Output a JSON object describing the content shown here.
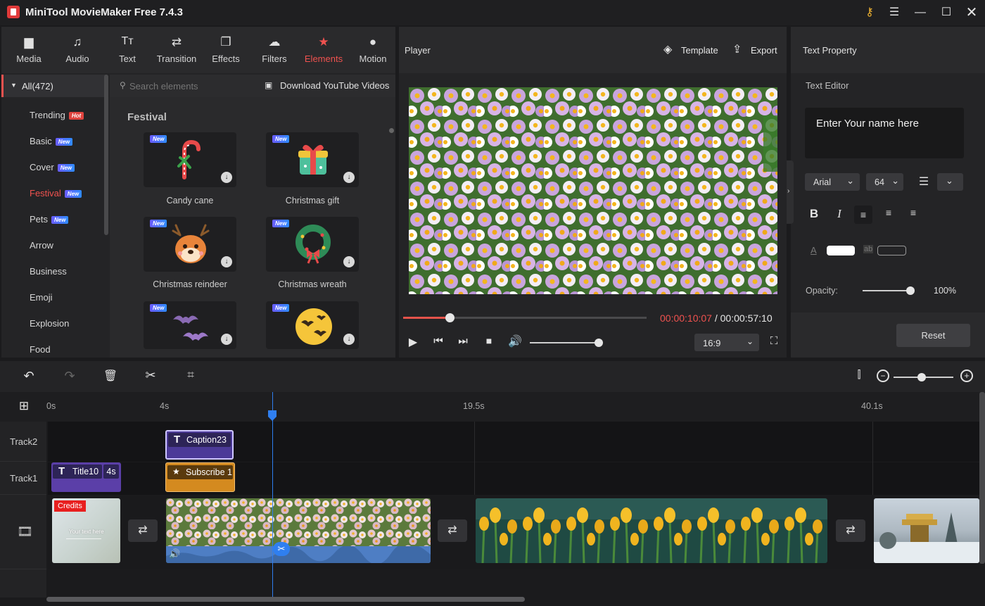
{
  "window": {
    "title": "MiniTool MovieMaker Free 7.4.3"
  },
  "tabs": [
    {
      "label": "Media",
      "icon": "folder-icon"
    },
    {
      "label": "Audio",
      "icon": "music-note-icon"
    },
    {
      "label": "Text",
      "icon": "text-icon"
    },
    {
      "label": "Transition",
      "icon": "transition-arrows-icon"
    },
    {
      "label": "Effects",
      "icon": "effects-icon"
    },
    {
      "label": "Filters",
      "icon": "filters-icon"
    },
    {
      "label": "Elements",
      "icon": "elements-icon"
    },
    {
      "label": "Motion",
      "icon": "motion-icon"
    }
  ],
  "active_tab": "Elements",
  "categories": {
    "all": "All(472)",
    "items": [
      {
        "label": "Trending",
        "badge": "Hot"
      },
      {
        "label": "Basic",
        "badge": "New"
      },
      {
        "label": "Cover",
        "badge": "New"
      },
      {
        "label": "Festival",
        "badge": "New"
      },
      {
        "label": "Pets",
        "badge": "New"
      },
      {
        "label": "Arrow",
        "badge": ""
      },
      {
        "label": "Business",
        "badge": ""
      },
      {
        "label": "Emoji",
        "badge": ""
      },
      {
        "label": "Explosion",
        "badge": ""
      },
      {
        "label": "Food",
        "badge": ""
      }
    ],
    "active": "Festival"
  },
  "search": {
    "placeholder": "Search elements",
    "download_label": "Download YouTube Videos"
  },
  "section_title": "Festival",
  "elements": [
    {
      "name": "Candy cane",
      "badge": "New"
    },
    {
      "name": "Christmas gift",
      "badge": "New"
    },
    {
      "name": "Christmas reindeer",
      "badge": "New"
    },
    {
      "name": "Christmas wreath",
      "badge": "New"
    },
    {
      "name": "",
      "badge": "New"
    },
    {
      "name": "",
      "badge": "New"
    }
  ],
  "player": {
    "title": "Player",
    "template_label": "Template",
    "export_label": "Export",
    "current_time": "00:00:10:07",
    "separator": " / ",
    "total_time": "00:00:57:10",
    "progress": 0.19,
    "volume": 0.98,
    "aspect_ratio": "16:9"
  },
  "text_property": {
    "title": "Text Property",
    "editor_label": "Text Editor",
    "text_value": "Enter Your name here",
    "font": "Arial",
    "size": "64",
    "opacity_label": "Opacity:",
    "opacity_value": "100%",
    "opacity": 1.0,
    "reset_label": "Reset",
    "color_label": "A",
    "bg_label": "ab"
  },
  "timeline": {
    "ruler_ticks": [
      "0s",
      "4s",
      "19.5s",
      "40.1s"
    ],
    "tracks": {
      "track2": "Track2",
      "track1": "Track1"
    },
    "clips": {
      "caption": "Caption23",
      "title": "Title10",
      "title_duration": "4s",
      "subscribe": "Subscribe 1",
      "credits_badge": "Credits",
      "credits_text": "Your text here"
    },
    "zoom": 0.47
  },
  "colors": {
    "accent": "#f0524f",
    "playhead": "#2f7ff0",
    "title_clip": "#5b3fa8",
    "element_clip": "#d48a1f"
  }
}
